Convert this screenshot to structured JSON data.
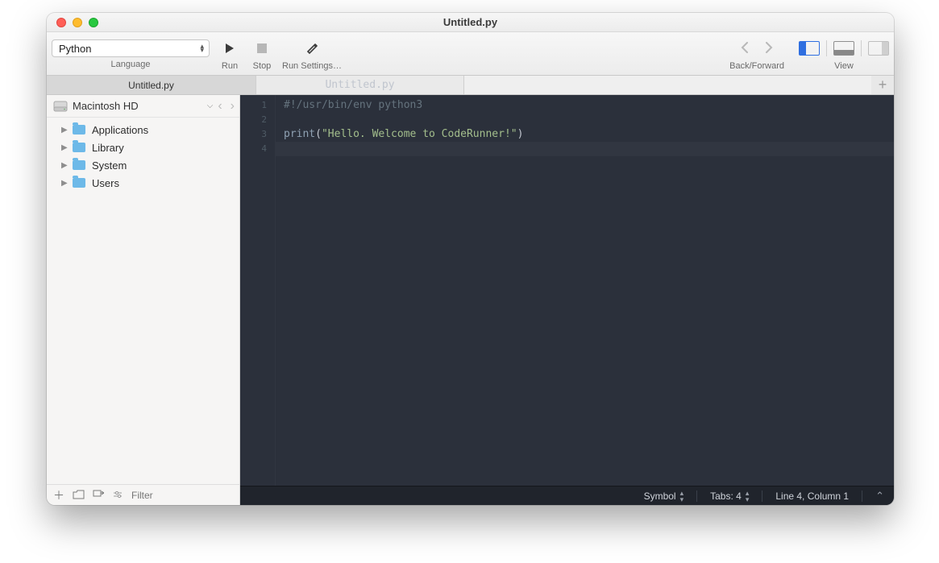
{
  "title": "Untitled.py",
  "toolbar": {
    "language": "Python",
    "language_caption": "Language",
    "run_caption": "Run",
    "stop_caption": "Stop",
    "runsettings_caption": "Run Settings…",
    "backforward_caption": "Back/Forward",
    "view_caption": "View"
  },
  "tabs": {
    "sidebar_tab": "Untitled.py",
    "editor_tab": "Untitled.py"
  },
  "sidebar": {
    "root": "Macintosh HD",
    "items": [
      "Applications",
      "Library",
      "System",
      "Users"
    ],
    "filter_placeholder": "Filter"
  },
  "code": {
    "lines": [
      {
        "n": "1",
        "tokens": [
          {
            "t": "#!/usr/bin/env python3",
            "c": "comment"
          }
        ]
      },
      {
        "n": "2",
        "tokens": []
      },
      {
        "n": "3",
        "tokens": [
          {
            "t": "print",
            "c": "kw"
          },
          {
            "t": "(",
            "c": "punc"
          },
          {
            "t": "\"Hello. Welcome to CodeRunner!\"",
            "c": "str"
          },
          {
            "t": ")",
            "c": "punc"
          }
        ]
      },
      {
        "n": "4",
        "tokens": [],
        "current": true
      }
    ]
  },
  "status": {
    "symbol": "Symbol",
    "tabs": "Tabs: 4",
    "cursor": "Line 4, Column 1"
  }
}
